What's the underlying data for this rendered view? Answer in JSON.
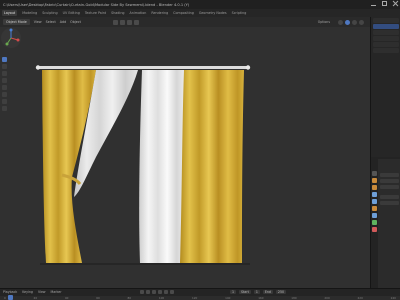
{
  "window": {
    "title": "C:\\Users\\User\\Desktop\\Fabric\\Curtain\\Curtain-Gold\\Modular Side By Sewmemi\\.blend - Blender 4.0.1 (Y)"
  },
  "workspaces": [
    "Layout",
    "Modeling",
    "Sculpting",
    "UV Editing",
    "Texture Paint",
    "Shading",
    "Animation",
    "Rendering",
    "Compositing",
    "Geometry Nodes",
    "Scripting"
  ],
  "viewport_header": {
    "mode": "Object Mode",
    "menus": [
      "View",
      "Select",
      "Add",
      "Object"
    ],
    "options_label": "Options"
  },
  "timeline": {
    "menus": [
      "Playback",
      "Keying",
      "View",
      "Marker"
    ],
    "start_label": "Start",
    "start": "1",
    "end_label": "End",
    "end": "250",
    "current_frame": "1",
    "ticks": [
      "0",
      "20",
      "40",
      "60",
      "80",
      "100",
      "120",
      "140",
      "160",
      "180",
      "200",
      "220",
      "240"
    ]
  },
  "colors": {
    "gold_fabric": "#d9b233",
    "white_fabric": "#ececec",
    "rod": "#dcdcdc",
    "accent": "#4f78c1",
    "viewport_bg": "#303030"
  },
  "icons": [
    "minimize-icon",
    "maximize-icon",
    "close-icon",
    "navigation-gizmo-icon",
    "playback-icon"
  ]
}
